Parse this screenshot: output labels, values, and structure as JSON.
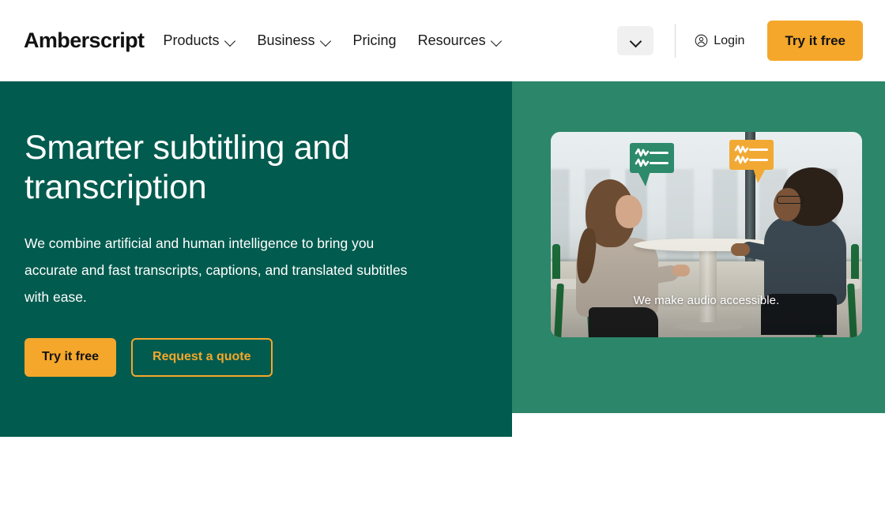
{
  "header": {
    "logo": "Amberscript",
    "nav": [
      {
        "label": "Products",
        "has_chevron": true,
        "icon": "chevron-down-icon"
      },
      {
        "label": "Business",
        "has_chevron": true,
        "icon": "chevron-down-icon"
      },
      {
        "label": "Pricing",
        "has_chevron": false,
        "icon": ""
      },
      {
        "label": "Resources",
        "has_chevron": true,
        "icon": "chevron-down-icon"
      }
    ],
    "language_selector_icon": "chevron-down-icon",
    "login_label": "Login",
    "login_icon": "user-circle-icon",
    "cta_label": "Try it free"
  },
  "hero": {
    "title": "Smarter subtitling and transcription",
    "subtitle": "We combine artificial and human intelligence to bring you accurate and fast transcripts, captions, and translated subtitles with ease.",
    "primary_cta": "Try it free",
    "secondary_cta": "Request a quote",
    "image_caption": "We make audio accessible.",
    "bubble_left_icon": "subtitle-waveform-icon",
    "bubble_right_icon": "subtitle-waveform-icon"
  },
  "colors": {
    "dark_green": "#015b4e",
    "mid_green": "#2c8669",
    "accent_orange": "#f5a72b",
    "text_dark": "#121212",
    "white": "#ffffff",
    "lang_box_bg": "#f0f0f0"
  }
}
